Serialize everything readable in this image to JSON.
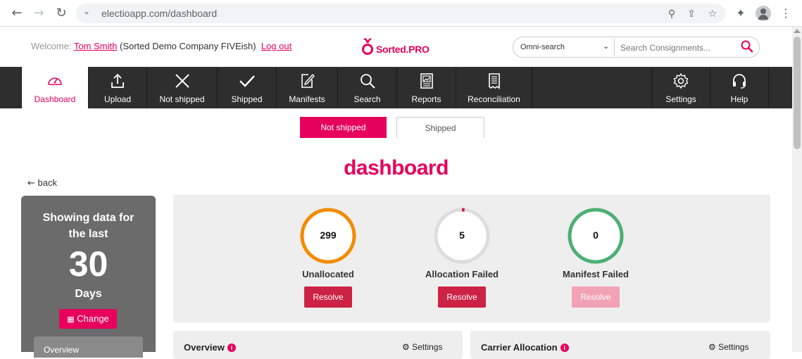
{
  "browser": {
    "url": "electioapp.com/dashboard"
  },
  "header": {
    "welcome_label": "Welcome:",
    "user_name": "Tom Smith",
    "company": "(Sorted Demo Company FIVEish)",
    "logout_label": "Log out",
    "logo_text": "Sorted.PRO",
    "omni_select": "Omni-search",
    "search_placeholder": "Search Consignments..."
  },
  "nav": {
    "items": [
      {
        "label": "Dashboard",
        "icon": "speedometer-icon"
      },
      {
        "label": "Upload",
        "icon": "upload-icon"
      },
      {
        "label": "Not shipped",
        "icon": "x-icon"
      },
      {
        "label": "Shipped",
        "icon": "check-icon"
      },
      {
        "label": "Manifests",
        "icon": "document-edit-icon"
      },
      {
        "label": "Search",
        "icon": "search-icon"
      },
      {
        "label": "Reports",
        "icon": "report-icon"
      },
      {
        "label": "Reconciliation",
        "icon": "receipt-icon"
      },
      {
        "label": "Settings",
        "icon": "gear-icon"
      },
      {
        "label": "Help",
        "icon": "headset-icon"
      }
    ]
  },
  "tabs": {
    "not_shipped": "Not shipped",
    "shipped": "Shipped"
  },
  "page_title": "dashboard",
  "back_label": "back",
  "side_panel": {
    "line1": "Showing data for",
    "line2": "the last",
    "number": "30",
    "unit": "Days",
    "change_label": "Change",
    "overview_label": "Overview"
  },
  "stats": [
    {
      "value": "299",
      "label": "Unallocated",
      "resolve": "Resolve",
      "color": "#f28c00",
      "fill": 1.0,
      "disabled": false
    },
    {
      "value": "5",
      "label": "Allocation Failed",
      "resolve": "Resolve",
      "color": "#cc2244",
      "fill": 0.016,
      "disabled": false
    },
    {
      "value": "0",
      "label": "Manifest Failed",
      "resolve": "Resolve",
      "color": "#4caf74",
      "fill": 1.0,
      "disabled": true
    }
  ],
  "cards": {
    "overview_title": "Overview",
    "overview_settings": "Settings",
    "carrier_title": "Carrier Allocation",
    "carrier_settings": "Settings"
  },
  "colors": {
    "brand": "#e6005c",
    "nav_bg": "#2e2e2e"
  }
}
